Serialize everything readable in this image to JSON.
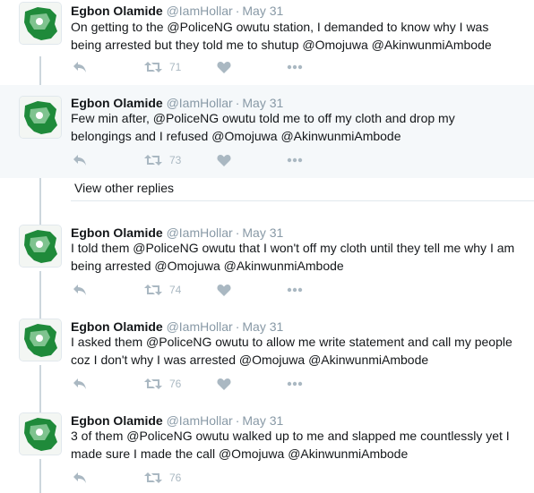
{
  "tweets": [
    {
      "name": "Egbon Olamide",
      "handle": "@IamHollar",
      "sep": "·",
      "date": "May 31",
      "text1": "On getting to the @PoliceNG owutu station, I demanded to know why I was",
      "text2": "being arrested but they told me to shutup @Omojuwa @AkinwunmiAmbode",
      "retweets": "71"
    },
    {
      "name": "Egbon Olamide",
      "handle": "@IamHollar",
      "sep": "·",
      "date": "May 31",
      "text1": "Few min after, @PoliceNG owutu told me to off my cloth and drop my",
      "text2": "belongings and I refused @Omojuwa @AkinwunmiAmbode",
      "retweets": "73"
    },
    {
      "name": "Egbon Olamide",
      "handle": "@IamHollar",
      "sep": "·",
      "date": "May 31",
      "text1": "I told them @PoliceNG owutu that I won't off my cloth until they tell me why I am",
      "text2": "being arrested  @Omojuwa @AkinwunmiAmbode",
      "retweets": "74"
    },
    {
      "name": "Egbon Olamide",
      "handle": "@IamHollar",
      "sep": "·",
      "date": "May 31",
      "text1": "I asked them @PoliceNG owutu to allow me write statement and call my people",
      "text2": "coz I don't why I was arrested @Omojuwa @AkinwunmiAmbode",
      "retweets": "76"
    },
    {
      "name": "Egbon Olamide",
      "handle": "@IamHollar",
      "sep": "·",
      "date": "May 31",
      "text1": "3 of them @PoliceNG owutu walked up to me and slapped me countlessly yet I",
      "text2": "made sure I made the call @Omojuwa @AkinwunmiAmbode",
      "retweets": "76"
    }
  ],
  "view_other_replies": "View other replies",
  "colors": {
    "text": "#14171a",
    "muted": "#8899a6",
    "icon": "#aab8c2",
    "highlight_bg": "#f5f8fa",
    "avatar_green": "#1f8a3a"
  },
  "icons": [
    "reply-icon",
    "retweet-icon",
    "like-icon",
    "more-icon"
  ]
}
